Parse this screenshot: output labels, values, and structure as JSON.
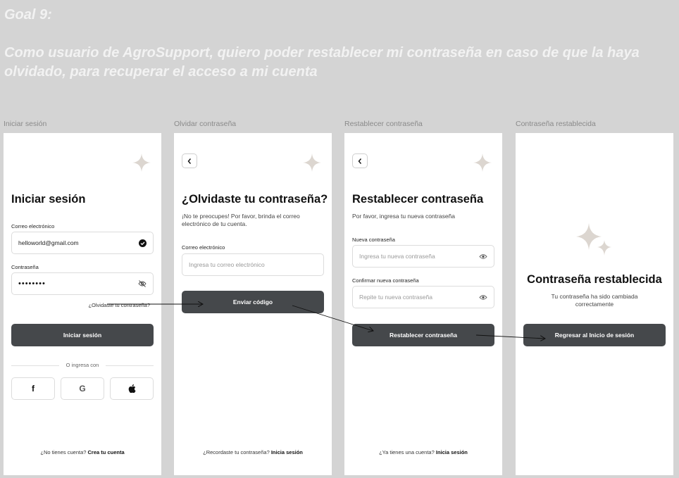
{
  "goal": {
    "title": "Goal 9:",
    "text": "Como usuario de AgroSupport, quiero poder restablecer mi contraseña en caso de que la haya olvidado, para recuperar el acceso a mi cuenta"
  },
  "screens": {
    "login": {
      "label": "Iniciar sesión",
      "title": "Iniciar sesión",
      "email_label": "Correo electrónico",
      "email_value": "helloworld@gmail.com",
      "password_label": "Contraseña",
      "password_value": "••••••••",
      "forgot_link": "¿Olvidaste tu contraseña?",
      "submit": "Iniciar sesión",
      "divider": "O ingresa con",
      "social": [
        "f",
        "G",
        ""
      ],
      "footer_text": "¿No tienes cuenta?",
      "footer_link": "Crea tu cuenta"
    },
    "forgot": {
      "label": "Olvidar contraseña",
      "title": "¿Olvidaste tu contraseña?",
      "subtitle": "¡No te preocupes! Por favor, brinda el correo electrónico de tu cuenta.",
      "email_label": "Correo electrónico",
      "email_placeholder": "Ingresa tu correo electrónico",
      "submit": "Enviar código",
      "footer_text": "¿Recordaste tu contraseña?",
      "footer_link": "Inicia sesión"
    },
    "reset": {
      "label": "Restablecer contraseña",
      "title": "Restablecer contraseña",
      "subtitle": "Por favor, ingresa tu nueva contraseña",
      "new_label": "Nueva contraseña",
      "new_placeholder": "Ingresa tu nueva contraseña",
      "confirm_label": "Confirmar nueva contraseña",
      "confirm_placeholder": "Repite tu nueva contraseña",
      "submit": "Restablecer contraseña",
      "footer_text": "¿Ya tienes una cuenta?",
      "footer_link": "Inicia sesión"
    },
    "done": {
      "label": "Contraseña restablecida",
      "title": "Contraseña restablecida",
      "subtitle": "Tu contraseña ha sido cambiada correctamente",
      "submit": "Regresar al Inicio de sesión"
    }
  },
  "colors": {
    "background": "#d4d4d4",
    "button": "#45484b",
    "sparkle": "#dcd6d0"
  }
}
